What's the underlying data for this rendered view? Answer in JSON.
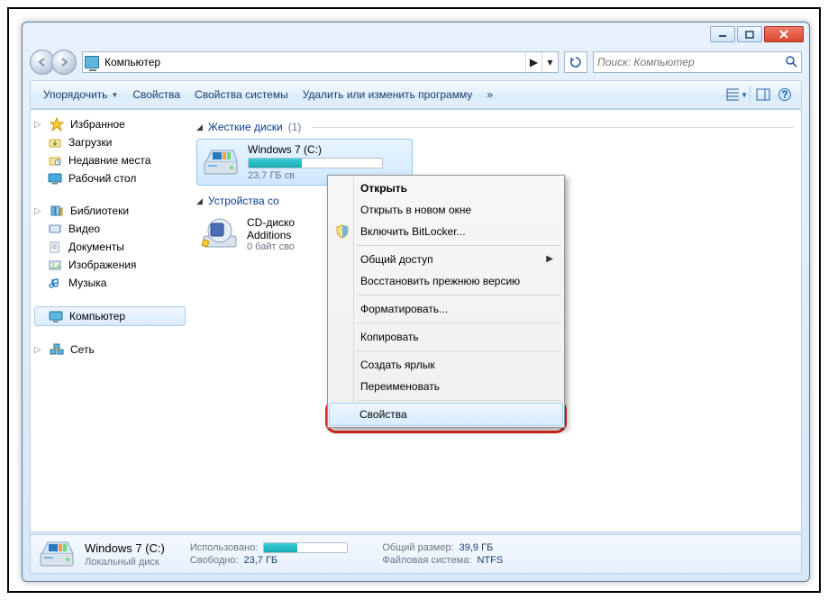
{
  "window": {
    "title": "Компьютер"
  },
  "address": {
    "location": "Компьютер",
    "separator": "▶"
  },
  "search": {
    "placeholder": "Поиск: Компьютер"
  },
  "toolbar": {
    "organize": "Упорядочить",
    "properties": "Свойства",
    "system_properties": "Свойства системы",
    "uninstall": "Удалить или изменить программу",
    "overflow": "»"
  },
  "sidebar": {
    "favorites": {
      "label": "Избранное",
      "items": [
        "Загрузки",
        "Недавние места",
        "Рабочий стол"
      ]
    },
    "libraries": {
      "label": "Библиотеки",
      "items": [
        "Видео",
        "Документы",
        "Изображения",
        "Музыка"
      ]
    },
    "computer": {
      "label": "Компьютер"
    },
    "network": {
      "label": "Сеть"
    }
  },
  "main": {
    "group_hdd": {
      "title": "Жесткие диски",
      "count": "(1)"
    },
    "drive_c": {
      "title": "Windows 7 (C:)",
      "free_text": "23,7 ГБ св",
      "fill_pct": 40
    },
    "group_removable": {
      "title": "Устройства со"
    },
    "cdrom": {
      "title": "CD-диско",
      "line2": "Additions",
      "sub": "0 байт сво"
    }
  },
  "context_menu": {
    "open": "Открыть",
    "open_new": "Открыть в новом окне",
    "bitlocker": "Включить BitLocker...",
    "sharing": "Общий доступ",
    "restore": "Восстановить прежнюю версию",
    "format": "Форматировать...",
    "copy": "Копировать",
    "shortcut": "Создать ярлык",
    "rename": "Переименовать",
    "properties": "Свойства"
  },
  "statusbar": {
    "title": "Windows 7 (C:)",
    "subtitle": "Локальный диск",
    "used_label": "Использовано:",
    "used_fill_pct": 40,
    "free_label": "Свободно:",
    "free_value": "23,7 ГБ",
    "total_label": "Общий размер:",
    "total_value": "39,9 ГБ",
    "fs_label": "Файловая система:",
    "fs_value": "NTFS"
  }
}
